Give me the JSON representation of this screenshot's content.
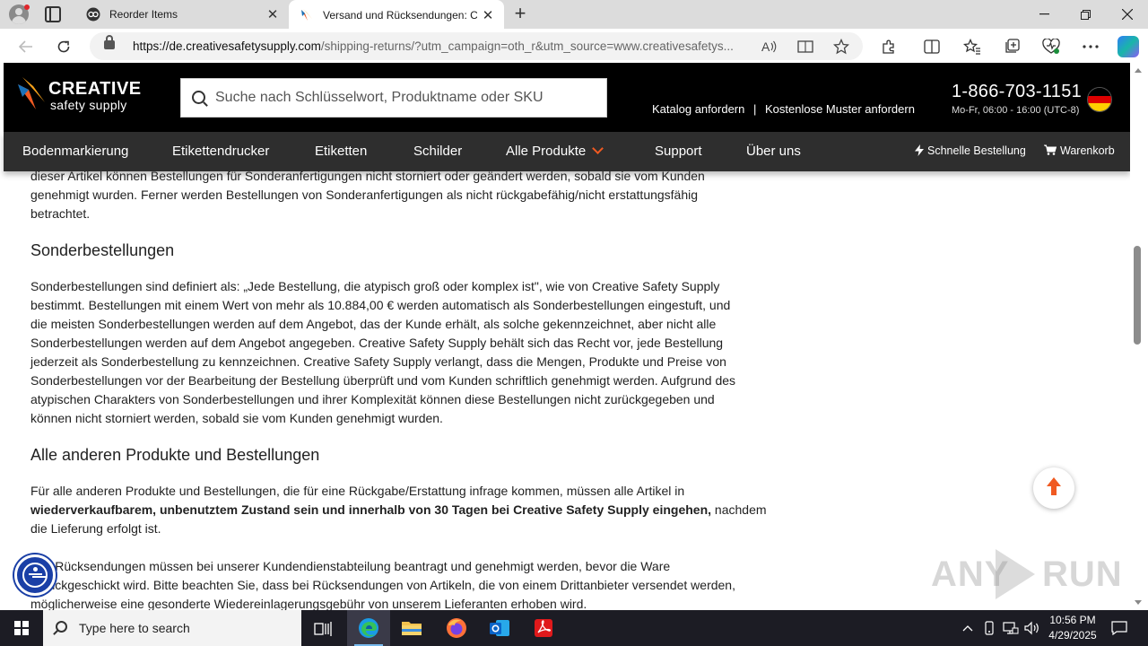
{
  "browser": {
    "tabs": [
      {
        "title": "Reorder Items",
        "favicon": "reorder-favicon",
        "active": false
      },
      {
        "title": "Versand und Rücksendungen: Cr",
        "favicon": "creative-safety-favicon",
        "active": true
      }
    ],
    "address": {
      "url_domain": "https://de.creativesafetysupply.com",
      "url_rest": "/shipping-returns/?utm_campaign=oth_r&utm_source=www.creativesafetys..."
    }
  },
  "site": {
    "logo": {
      "word1": "CREATIVE",
      "word2": "safety supply"
    },
    "search_placeholder": "Suche nach Schlüsselwort, Produktname oder SKU",
    "header_links": {
      "catalog": "Katalog anfordern",
      "separator": "|",
      "samples": "Kostenlose Muster anfordern"
    },
    "phone": "1-866-703-1151",
    "hours": "Mo-Fr, 06:00 - 16:00 (UTC-8)",
    "nav": [
      "Bodenmarkierung",
      "Etikettendrucker",
      "Etiketten",
      "Schilder",
      "Alle Produkte",
      "Support",
      "Über uns"
    ],
    "quick_order": "Schnelle Bestellung",
    "cart": "Warenkorb",
    "accent_color": "#f05a22"
  },
  "content": {
    "intro_lines": [
      "dieser Artikel können Bestellungen für Sonderanfertigungen nicht storniert oder geändert werden, sobald sie vom Kunden",
      "genehmigt wurden. Ferner werden Bestellungen von Sonderanfertigungen als nicht rückgabefähig/nicht erstattungsfähig",
      "betrachtet."
    ],
    "h_special": "Sonderbestellungen",
    "special_lines": [
      "Sonderbestellungen sind definiert als: „Jede Bestellung, die atypisch groß oder komplex ist\", wie von Creative Safety Supply",
      "bestimmt. Bestellungen mit einem Wert von mehr als 10.884,00 € werden automatisch als Sonderbestellungen eingestuft, und",
      "die meisten Sonderbestellungen werden auf dem Angebot, das der Kunde erhält, als solche gekennzeichnet, aber nicht alle",
      "Sonderbestellungen werden auf dem Angebot angegeben. Creative Safety Supply behält sich das Recht vor, jede Bestellung",
      "jederzeit als Sonderbestellung zu kennzeichnen. Creative Safety Supply verlangt, dass die Mengen, Produkte und Preise von",
      "Sonderbestellungen vor der Bearbeitung der Bestellung überprüft und vom Kunden schriftlich genehmigt werden. Aufgrund des",
      "atypischen Charakters von Sonderbestellungen und ihrer Komplexität können diese Bestellungen nicht zurückgegeben und",
      "können nicht storniert werden, sobald sie vom Kunden genehmigt wurden."
    ],
    "h_other": "Alle anderen Produkte und Bestellungen",
    "other_line1": "Für alle anderen Produkte und Bestellungen, die für eine Rückgabe/Erstattung infrage kommen, müssen alle Artikel in",
    "other_bold": "wiederverkaufbarem, unbenutztem Zustand sein und innerhalb von 30 Tagen bei Creative Safety Supply eingehen,",
    "other_after_bold": " nachdem",
    "other_line3": "die Lieferung erfolgt ist.",
    "returns_lines": [
      "Alle Rücksendungen müssen bei unserer Kundendienstabteilung beantragt und genehmigt werden, bevor die Ware",
      "zurückgeschickt wird. Bitte beachten Sie, dass bei Rücksendungen von Artikeln, die von einem Drittanbieter versendet werden,",
      "möglicherweise eine gesonderte Wiedereinlagerungsgebühr von unserem Lieferanten erhoben wird."
    ]
  },
  "taskbar": {
    "search_text": "Type here to search",
    "time": "10:56 PM",
    "date": "4/29/2025"
  },
  "watermark": {
    "left": "ANY",
    "right": "RUN"
  }
}
